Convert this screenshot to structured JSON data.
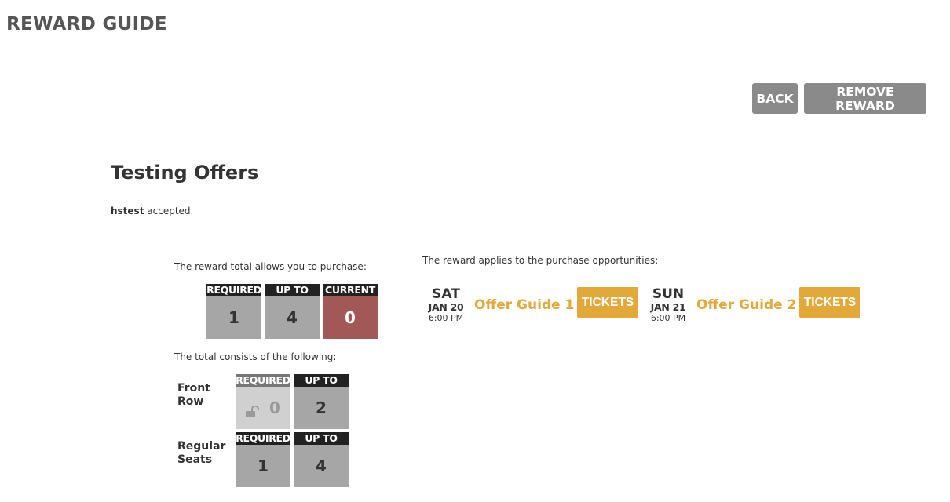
{
  "header": {
    "title": "REWARD GUIDE"
  },
  "actions": {
    "back_label": "BACK",
    "remove_label": "REMOVE REWARD"
  },
  "offer": {
    "title": "Testing Offers",
    "accepted_code": "hstest",
    "accepted_suffix": " accepted."
  },
  "summary": {
    "intro": "The reward total allows you to purchase:",
    "boxes": [
      {
        "header": "REQUIRED",
        "value": "1"
      },
      {
        "header": "UP TO",
        "value": "4"
      },
      {
        "header": "CURRENT",
        "value": "0"
      }
    ]
  },
  "breakdown": {
    "intro": "The total consists of the following:",
    "categories": [
      {
        "name_line1": "Front",
        "name_line2": "Row",
        "required_header": "REQUIRED",
        "required_value": "0",
        "required_locked": true,
        "upto_header": "UP TO",
        "upto_value": "2"
      },
      {
        "name_line1": "Regular",
        "name_line2": "Seats",
        "required_header": "REQUIRED",
        "required_value": "1",
        "required_locked": false,
        "upto_header": "UP TO",
        "upto_value": "4"
      }
    ]
  },
  "opportunities": {
    "intro": "The reward applies to the purchase opportunities:",
    "events": [
      {
        "dow": "SAT",
        "date": "JAN 20",
        "time": "6:00 PM",
        "name": "Offer Guide 1",
        "button": "TICKETS"
      },
      {
        "dow": "SUN",
        "date": "JAN 21",
        "time": "6:00 PM",
        "name": "Offer Guide 2",
        "button": "TICKETS"
      }
    ]
  },
  "colors": {
    "accent": "#e2a93a",
    "current_box": "#a35858",
    "box_gray": "#a6a6a6",
    "button_gray": "#8a8a8a"
  },
  "icons": {
    "lock": "unlocked-padlock-icon"
  }
}
